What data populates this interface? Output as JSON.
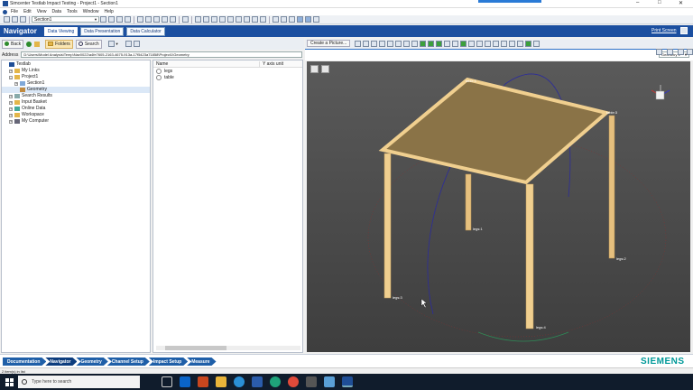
{
  "window": {
    "title": "Simcenter Testlab Impact Testing - Project1 - Section1",
    "minimize": "–",
    "maximize": "□",
    "close": "✕"
  },
  "menu": {
    "items": [
      "File",
      "Edit",
      "View",
      "Data",
      "Tools",
      "Window",
      "Help"
    ]
  },
  "toolbar": {
    "section_select": "Section1"
  },
  "navigator": {
    "title": "Navigator",
    "tabs": [
      "Data Viewing",
      "Data Presentation",
      "Data Calculator"
    ],
    "active_tab": 0,
    "print_label": "Print Screen"
  },
  "left": {
    "back_label": "Back",
    "folders_label": "Folders",
    "search_label": "Search",
    "address_label": "Address",
    "address_value": "D:\\Users\\Model Analysis\\Temp\\Nav0022\\a4fe7605-2163-4675-913a-17f5423a71858\\Project1\\Geometry",
    "tree": [
      {
        "label": "Testlab",
        "level": 0,
        "toggle": "",
        "icon": "testlab"
      },
      {
        "label": "My Links",
        "level": 1,
        "toggle": "+",
        "icon": "folder"
      },
      {
        "label": "Project1",
        "level": 1,
        "toggle": "–",
        "icon": "project"
      },
      {
        "label": "Section1",
        "level": 2,
        "toggle": "+",
        "icon": "section"
      },
      {
        "label": "Geometry",
        "level": 2,
        "toggle": "",
        "icon": "geometry"
      },
      {
        "label": "Search Results",
        "level": 1,
        "toggle": "+",
        "icon": "search"
      },
      {
        "label": "Input Basket",
        "level": 1,
        "toggle": "+",
        "icon": "folder"
      },
      {
        "label": "Online Data",
        "level": 1,
        "toggle": "+",
        "icon": "online"
      },
      {
        "label": "Workspace",
        "level": 1,
        "toggle": "+",
        "icon": "folder"
      },
      {
        "label": "My Computer",
        "level": 1,
        "toggle": "+",
        "icon": "computer"
      }
    ],
    "list_headers": [
      "Name",
      "Y axis unit"
    ],
    "list_items": [
      "legs",
      "table"
    ]
  },
  "viewer": {
    "create_picture_label": "Create a Picture...",
    "geometry_select": "Geometry 1",
    "point_labels": [
      "table:3",
      "table:1",
      "legs:1",
      "legs:2",
      "legs:3",
      "legs:4"
    ]
  },
  "workflow": {
    "steps": [
      "Documentation",
      "Navigator",
      "Geometry",
      "Channel Setup",
      "Impact Setup",
      "Measure"
    ],
    "active": 1,
    "brand": "SIEMENS"
  },
  "status": {
    "text": "2 item(s) in list"
  },
  "taskbar": {
    "search_placeholder": "Type here to search"
  },
  "colors": {
    "title_bar_blue": "#1f4e96",
    "navigator_bar": "#1b4fa0",
    "viewport_bg": "#4a4a4a",
    "wood": "#f0cf8f",
    "tabletop": "#8a7347",
    "siemens": "#009999"
  }
}
